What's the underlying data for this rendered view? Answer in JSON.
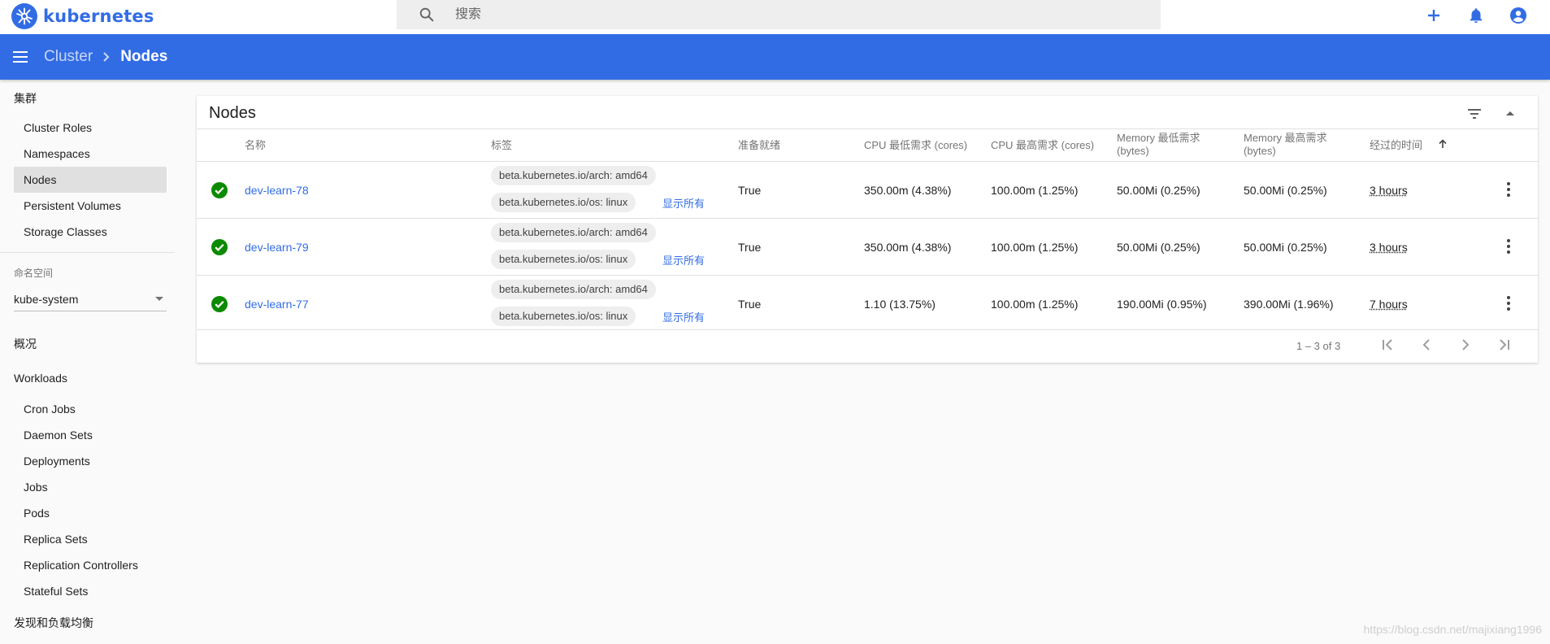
{
  "topbar": {
    "logo_text": "kubernetes",
    "search_placeholder": "搜索",
    "icons": [
      "search-icon",
      "add-icon",
      "notifications-icon",
      "account-icon"
    ]
  },
  "header": {
    "breadcrumb_parent": "Cluster",
    "breadcrumb_current": "Nodes"
  },
  "sidebar": {
    "cluster_section": "集群",
    "cluster_items": [
      {
        "label": "Cluster Roles",
        "active": false
      },
      {
        "label": "Namespaces",
        "active": false
      },
      {
        "label": "Nodes",
        "active": true
      },
      {
        "label": "Persistent Volumes",
        "active": false
      },
      {
        "label": "Storage Classes",
        "active": false
      }
    ],
    "namespace_label": "命名空间",
    "namespace_value": "kube-system",
    "overview": "概况",
    "workloads_section": "Workloads",
    "workload_items": [
      {
        "label": "Cron Jobs"
      },
      {
        "label": "Daemon Sets"
      },
      {
        "label": "Deployments"
      },
      {
        "label": "Jobs"
      },
      {
        "label": "Pods"
      },
      {
        "label": "Replica Sets"
      },
      {
        "label": "Replication Controllers"
      },
      {
        "label": "Stateful Sets"
      }
    ],
    "discovery_section": "发现和负载均衡"
  },
  "card": {
    "title": "Nodes",
    "columns": {
      "name": "名称",
      "labels": "标签",
      "ready": "准备就绪",
      "cpu_requests": "CPU 最低需求 (cores)",
      "cpu_limits": "CPU 最高需求 (cores)",
      "memory_requests_1": "Memory 最低需求",
      "memory_requests_2": "(bytes)",
      "memory_limits_1": "Memory 最高需求",
      "memory_limits_2": "(bytes)",
      "age": "经过的时间"
    },
    "rows": [
      {
        "status": "ok",
        "name": "dev-learn-78",
        "label_arch": "beta.kubernetes.io/arch: amd64",
        "label_os": "beta.kubernetes.io/os: linux",
        "show_all": "显示所有",
        "ready": "True",
        "cpu_requests": "350.00m (4.38%)",
        "cpu_limits": "100.00m (1.25%)",
        "memory_requests": "50.00Mi (0.25%)",
        "memory_limits": "50.00Mi (0.25%)",
        "age": "3 hours"
      },
      {
        "status": "ok",
        "name": "dev-learn-79",
        "label_arch": "beta.kubernetes.io/arch: amd64",
        "label_os": "beta.kubernetes.io/os: linux",
        "show_all": "显示所有",
        "ready": "True",
        "cpu_requests": "350.00m (4.38%)",
        "cpu_limits": "100.00m (1.25%)",
        "memory_requests": "50.00Mi (0.25%)",
        "memory_limits": "50.00Mi (0.25%)",
        "age": "3 hours"
      },
      {
        "status": "ok",
        "name": "dev-learn-77",
        "label_arch": "beta.kubernetes.io/arch: amd64",
        "label_os": "beta.kubernetes.io/os: linux",
        "show_all": "显示所有",
        "ready": "True",
        "cpu_requests": "1.10 (13.75%)",
        "cpu_limits": "100.00m (1.25%)",
        "memory_requests": "190.00Mi (0.95%)",
        "memory_limits": "390.00Mi (1.96%)",
        "age": "7 hours"
      }
    ],
    "pagination": {
      "range": "1 – 3 of 3"
    }
  },
  "watermark": "https://blog.csdn.net/majixiang1996",
  "colors": {
    "brand": "#326ce5",
    "ok_green": "#0b8a00",
    "active_nav": "#e0e0e0"
  }
}
